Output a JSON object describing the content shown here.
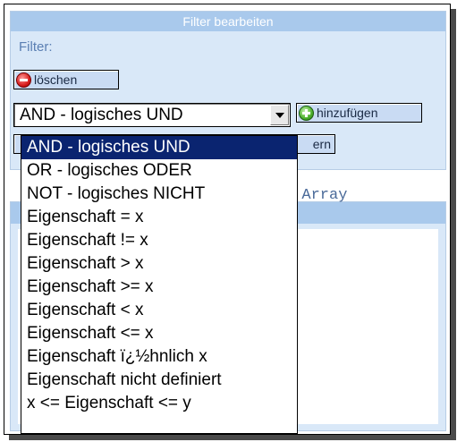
{
  "panel": {
    "title": "Filter bearbeiten",
    "filter_label": "Filter:"
  },
  "buttons": {
    "delete_label": "löschen",
    "add_label": "hinzufügen",
    "partial_label": "ern"
  },
  "select": {
    "value": "AND - logisches UND",
    "options": [
      "AND - logisches UND",
      "OR - logisches ODER",
      "NOT - logisches NICHT",
      "Eigenschaft = x",
      "Eigenschaft != x",
      "Eigenschaft > x",
      "Eigenschaft >= x",
      "Eigenschaft < x",
      "Eigenschaft <= x",
      "Eigenschaft ï¿½hnlich x",
      "Eigenschaft nicht definiert",
      "x <= Eigenschaft <= y"
    ]
  },
  "background_code": "> Array",
  "icons": {
    "delete": "minus-circle-icon",
    "add": "plus-circle-icon",
    "dropdown": "chevron-down-icon"
  },
  "colors": {
    "panel_bg": "#d9e8f8",
    "header_bg": "#a9c9ec",
    "selected_bg": "#0a2470"
  }
}
